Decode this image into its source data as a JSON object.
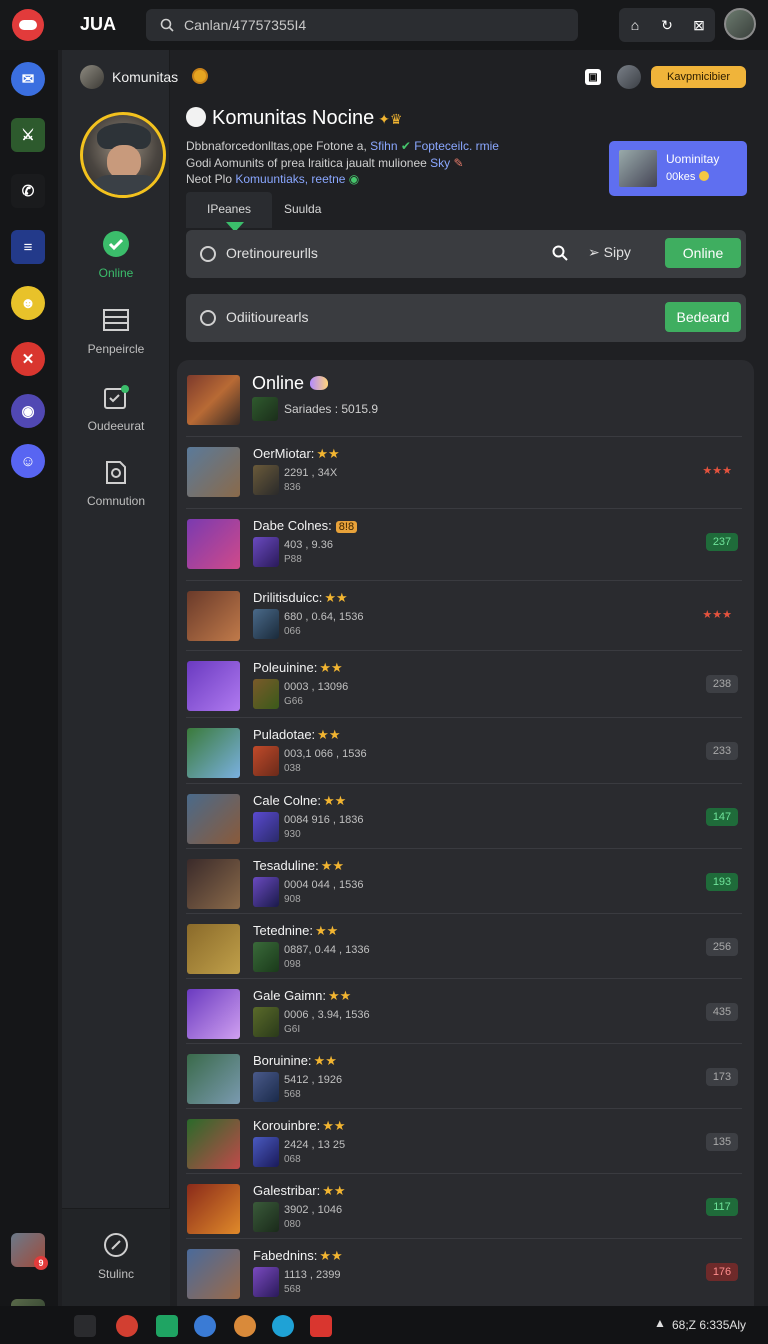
{
  "topbar": {
    "app_name": "JUA",
    "search_value": "Canlan/47757355I4",
    "icons": [
      "home-icon",
      "refresh-icon",
      "notification-icon",
      "user-icon"
    ]
  },
  "rail": {
    "items": [
      {
        "name": "mail-icon",
        "color": "#3b6fe0",
        "glyph": "✉"
      },
      {
        "name": "game-icon",
        "color": "#2d5a2d",
        "glyph": "⚔",
        "badge": "•"
      },
      {
        "name": "phone-icon",
        "color": "#1a1b1d",
        "glyph": "✆"
      },
      {
        "name": "list-icon",
        "color": "#233a8a",
        "glyph": "≡"
      },
      {
        "name": "face-icon",
        "color": "#e8c22a",
        "glyph": "☻"
      },
      {
        "name": "x-app-icon",
        "color": "#d9362f",
        "glyph": "✕"
      },
      {
        "name": "record-icon",
        "color": "#5148b3",
        "glyph": "◉"
      },
      {
        "name": "chat-icon",
        "color": "#5865f2",
        "glyph": "☺"
      }
    ],
    "bottom_badge": "9"
  },
  "subnav": {
    "items": [
      {
        "label": "Online",
        "icon": "check-circle-icon",
        "active": true
      },
      {
        "label": "Penpeircle",
        "icon": "list-icon",
        "active": false
      },
      {
        "label": "Oudeeurat",
        "icon": "calendar-icon",
        "active": false
      },
      {
        "label": "Comnution",
        "icon": "document-icon",
        "active": false
      }
    ],
    "footer_label": "Stulinc"
  },
  "header": {
    "crumb": "Komunitas",
    "pill": "Kavpmicibier"
  },
  "hero": {
    "title": "Komunitas Nocine",
    "line1_a": "Dbbnaforcedonlltas,ope Fotone a,",
    "line1_b": "Sfihn",
    "line1_c": "Fopteceilc. rmie",
    "line2_a": "Godi Aomunits of prea lraitica jaualt mulionee",
    "line2_b": "Sky",
    "line3_a": "Neot Plo",
    "line3_b": "Komuuntiaks, reetne"
  },
  "promo": {
    "title": "Uominitay",
    "sub": "00kes"
  },
  "tabs": {
    "t1": "IPeanes",
    "t2": "Suulda"
  },
  "bar1": {
    "label": "Oretinoureurlls",
    "action": "Sipy",
    "button": "Online"
  },
  "bar2": {
    "label": "Odiitiourearls",
    "button": "Bedeard"
  },
  "panel": {
    "title": "Online",
    "subtitle": "Sariades : 5015.9"
  },
  "rows": [
    {
      "name": "OerMiotar:",
      "stars": "★★",
      "stats": "2291 , 34X",
      "stats2": "836",
      "badge": "★★★",
      "badge_type": "stars",
      "thumb": [
        "#5a7a9a",
        "#8a6a4a"
      ],
      "mini": [
        "#6a5a3a",
        "#2a2a2a"
      ]
    },
    {
      "name": "Dabe Colnes:",
      "stars": "",
      "tag": "8!8",
      "stats": "403 , 9.36",
      "stats2": "P88",
      "badge": "237",
      "badge_type": "green",
      "thumb": [
        "#7a3ab0",
        "#d04a8a"
      ],
      "mini": [
        "#6a4ac0",
        "#2a1a5a"
      ]
    },
    {
      "name": "Drilitisduicc:",
      "stars": "★★",
      "stats": "680 , 0.64, 1536",
      "stats2": "066",
      "badge": "★★★",
      "badge_type": "stars",
      "thumb": [
        "#6a3a2a",
        "#c07a4a"
      ],
      "mini": [
        "#4a6a8a",
        "#1a2a3a"
      ]
    },
    {
      "name": "Poleuinine:",
      "stars": "★★",
      "stats": "0003 , 13096",
      "stats2": "G66",
      "badge": "238",
      "badge_type": "gray",
      "thumb": [
        "#6a3ac0",
        "#b07af0"
      ],
      "mini": [
        "#7a5a2a",
        "#3a5a1a"
      ]
    },
    {
      "name": "Puladotae:",
      "stars": "★★",
      "stats": "003,1 066 , 1536",
      "stats2": "038",
      "badge": "233",
      "badge_type": "gray",
      "thumb": [
        "#3a7a3a",
        "#7ab0e0"
      ],
      "mini": [
        "#c04a2a",
        "#6a2a1a"
      ]
    },
    {
      "name": "Cale Colne:",
      "stars": "★★",
      "stats": "0084 916 , 1836",
      "stats2": "930",
      "badge": "147",
      "badge_type": "green",
      "thumb": [
        "#4a6a8a",
        "#8a5a3a"
      ],
      "mini": [
        "#5a4ad0",
        "#2a2a6a"
      ]
    },
    {
      "name": "Tesaduline:",
      "stars": "★★",
      "stats": "0004 044 , 1536",
      "stats2": "908",
      "badge": "193",
      "badge_type": "green",
      "thumb": [
        "#3a2a2a",
        "#8a6a4a"
      ],
      "mini": [
        "#6a4ac0",
        "#1a1a4a"
      ]
    },
    {
      "name": "Tetednine:",
      "stars": "★★",
      "stats": "0887, 0.44 , 1336",
      "stats2": "098",
      "badge": "256",
      "badge_type": "gray",
      "thumb": [
        "#8a6a2a",
        "#c0a04a"
      ],
      "mini": [
        "#3a6a3a",
        "#1a3a1a"
      ]
    },
    {
      "name": "Gale Gaimn:",
      "stars": "★★",
      "stats": "0006 , 3.94, 1536",
      "stats2": "G6I",
      "badge": "435",
      "badge_type": "gray",
      "thumb": [
        "#6a3ac0",
        "#d0a0f0"
      ],
      "mini": [
        "#5a6a2a",
        "#2a3a1a"
      ]
    },
    {
      "name": "Boruinine:",
      "stars": "★★",
      "stats": "5412 , 1926",
      "stats2": "568",
      "badge": "173",
      "badge_type": "gray",
      "thumb": [
        "#3a6a4a",
        "#7a9ab0"
      ],
      "mini": [
        "#4a5a8a",
        "#1a2a4a"
      ]
    },
    {
      "name": "Korouinbre:",
      "stars": "★★",
      "stats": "2424 , 13 25",
      "stats2": "068",
      "badge": "135",
      "badge_type": "gray",
      "thumb": [
        "#2a6a2a",
        "#c04a4a"
      ],
      "mini": [
        "#4a5ac0",
        "#1a1a5a"
      ]
    },
    {
      "name": "Galestribar:",
      "stars": "★★",
      "stats": "3902 , 1046",
      "stats2": "080",
      "badge": "117",
      "badge_type": "green",
      "thumb": [
        "#8a2a1a",
        "#e08a2a"
      ],
      "mini": [
        "#3a5a3a",
        "#1a2a1a"
      ]
    },
    {
      "name": "Fabednins:",
      "stars": "★★",
      "stats": "1113 , 2399",
      "stats2": "568",
      "badge": "176",
      "badge_type": "red",
      "thumb": [
        "#4a6a9a",
        "#9a6a4a"
      ],
      "mini": [
        "#7a4ac0",
        "#2a1a5a"
      ]
    }
  ],
  "taskbar": {
    "time": "68;Z 6:335Aly",
    "apps": [
      {
        "name": "windows-icon",
        "color": "#2a2b2e"
      },
      {
        "name": "chrome-icon",
        "color": "#d23f31"
      },
      {
        "name": "sheets-icon",
        "color": "#1fa463"
      },
      {
        "name": "browser-icon",
        "color": "#3a7bd5"
      },
      {
        "name": "cookie-icon",
        "color": "#d98a3a"
      },
      {
        "name": "edge-icon",
        "color": "#1fa2d6"
      },
      {
        "name": "record-icon",
        "color": "#d9362f"
      }
    ]
  }
}
